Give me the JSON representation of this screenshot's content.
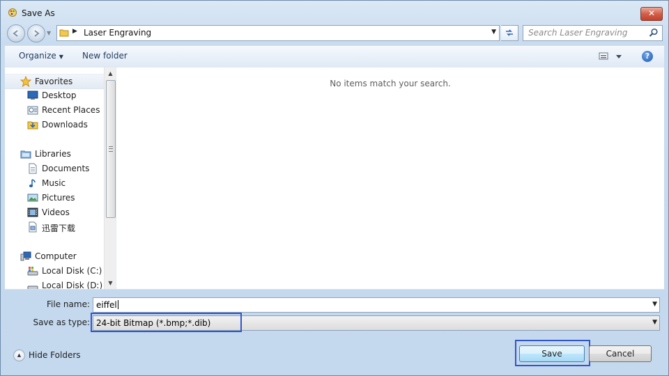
{
  "window": {
    "title": "Save As",
    "close_icon": "close-icon"
  },
  "nav": {
    "address": "Laser Engraving",
    "search_placeholder": "Search Laser Engraving"
  },
  "toolbar": {
    "organize": "Organize",
    "new_folder": "New folder",
    "help": "?"
  },
  "sidebar": {
    "items": [
      {
        "label": "Favorites",
        "icon": "star-icon"
      },
      {
        "label": "Desktop",
        "icon": "desktop-icon"
      },
      {
        "label": "Recent Places",
        "icon": "recent-places-icon"
      },
      {
        "label": "Downloads",
        "icon": "downloads-icon"
      },
      {
        "label": "Libraries",
        "icon": "libraries-icon"
      },
      {
        "label": "Documents",
        "icon": "documents-icon"
      },
      {
        "label": "Music",
        "icon": "music-icon"
      },
      {
        "label": "Pictures",
        "icon": "pictures-icon"
      },
      {
        "label": "Videos",
        "icon": "videos-icon"
      },
      {
        "label": "迅雷下载",
        "icon": "folder-icon"
      },
      {
        "label": "Computer",
        "icon": "computer-icon"
      },
      {
        "label": "Local Disk (C:)",
        "icon": "drive-icon"
      },
      {
        "label": "Local Disk (D:)",
        "icon": "drive-icon"
      }
    ]
  },
  "main": {
    "empty_message": "No items match your search."
  },
  "fields": {
    "file_name_label": "File name:",
    "file_name_value": "eiffel",
    "save_type_label": "Save as type:",
    "save_type_value": "24-bit Bitmap (*.bmp;*.dib)"
  },
  "footer": {
    "hide_folders": "Hide Folders",
    "save": "Save",
    "cancel": "Cancel"
  },
  "colors": {
    "highlight_box": "#3056c9",
    "window_frame": "#c4d8ee"
  }
}
